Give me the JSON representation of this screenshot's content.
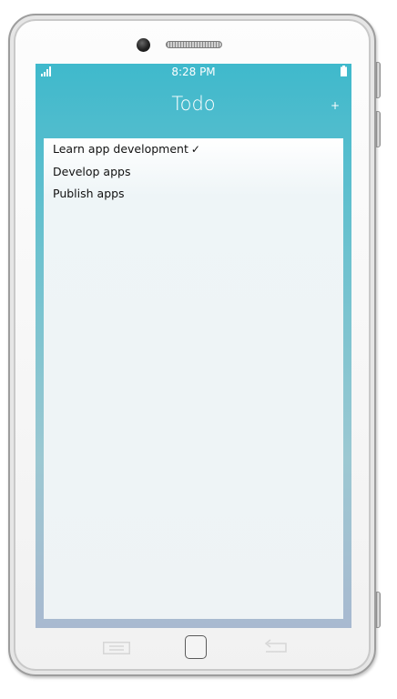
{
  "status_bar": {
    "time": "8:28 PM",
    "signal_icon": "signal-bars-icon",
    "battery_icon": "battery-icon"
  },
  "header": {
    "title": "Todo",
    "add_label": "+"
  },
  "todos": [
    {
      "text": "Learn app development",
      "done": true,
      "mark": "✓"
    },
    {
      "text": "Develop apps",
      "done": false,
      "mark": ""
    },
    {
      "text": "Publish apps",
      "done": false,
      "mark": ""
    }
  ],
  "nav": {
    "menu_icon": "menu-icon",
    "home_icon": "home-icon",
    "back_icon": "back-icon"
  },
  "colors": {
    "header_accent": "#3fb9cc",
    "screen_bottom": "#a8b9d0",
    "text": "#111111"
  }
}
